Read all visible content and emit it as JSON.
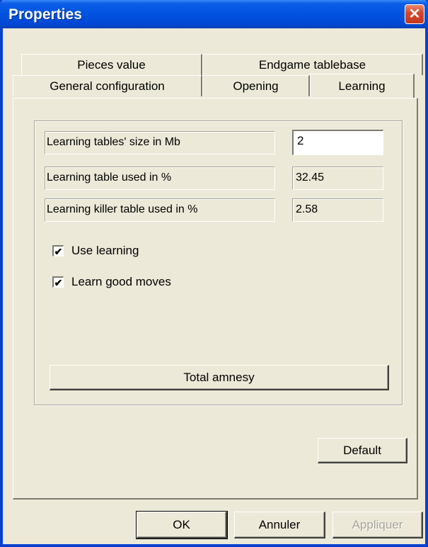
{
  "window": {
    "title": "Properties"
  },
  "tabs": {
    "back_row": [
      "Pieces value",
      "Endgame tablebase"
    ],
    "front_row": [
      "General configuration",
      "Opening",
      "Learning"
    ],
    "active": "Learning"
  },
  "learning": {
    "table_size_label": "Learning tables' size in Mb",
    "table_size_value": "2",
    "table_used_label": "Learning table used in %",
    "table_used_value": "32.45",
    "killer_used_label": "Learning killer table used in %",
    "killer_used_value": "2.58",
    "use_learning_label": "Use learning",
    "use_learning_checked": true,
    "learn_good_moves_label": "Learn good moves",
    "learn_good_moves_checked": true,
    "total_amnesy_label": "Total amnesy"
  },
  "buttons": {
    "default_label": "Default",
    "ok_label": "OK",
    "cancel_label": "Annuler",
    "apply_label": "Appliquer"
  },
  "icons": {
    "close": "close-icon",
    "check": "check-icon"
  },
  "colors": {
    "titlebar": "#0053e0",
    "close": "#d4442a",
    "dialog": "#ece9d8"
  }
}
